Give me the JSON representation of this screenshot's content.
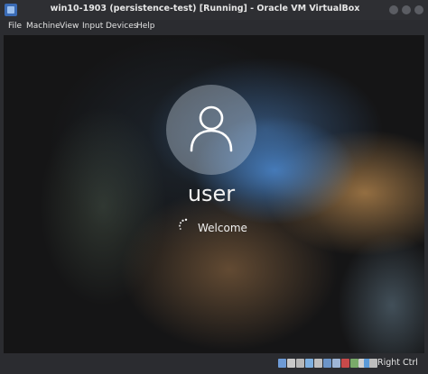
{
  "window": {
    "title": "win10-1903 (persistence-test) [Running] - Oracle VM VirtualBox"
  },
  "menu": {
    "items": [
      "File",
      "Machine",
      "View",
      "Input",
      "Devices",
      "Help"
    ]
  },
  "guest": {
    "username": "user",
    "status_text": "Welcome"
  },
  "statusbar": {
    "host_key_label": "Right Ctrl",
    "icons": [
      "hard-disk-icon",
      "optical-drive-icon",
      "audio-icon",
      "network-icon",
      "usb-icon",
      "shared-folders-icon",
      "display-icon",
      "video-capture-icon",
      "cpu-icon",
      "mouse-integration-icon",
      "arrow-down-icon",
      "keyboard-icon"
    ],
    "icon_colors": [
      "#6e9bd6",
      "#c9c9c9",
      "#b8b8b8",
      "#7fb0e0",
      "#c0c0c0",
      "#6d95c8",
      "#9fb6d6",
      "#c84a4a",
      "#7aaa6a",
      "#cfcfcf",
      "#5a9ad8",
      "#bdbdbd"
    ]
  },
  "colors": {
    "titlebar_bg": "#2e2f33",
    "menubar_bg": "#2b2c30"
  }
}
